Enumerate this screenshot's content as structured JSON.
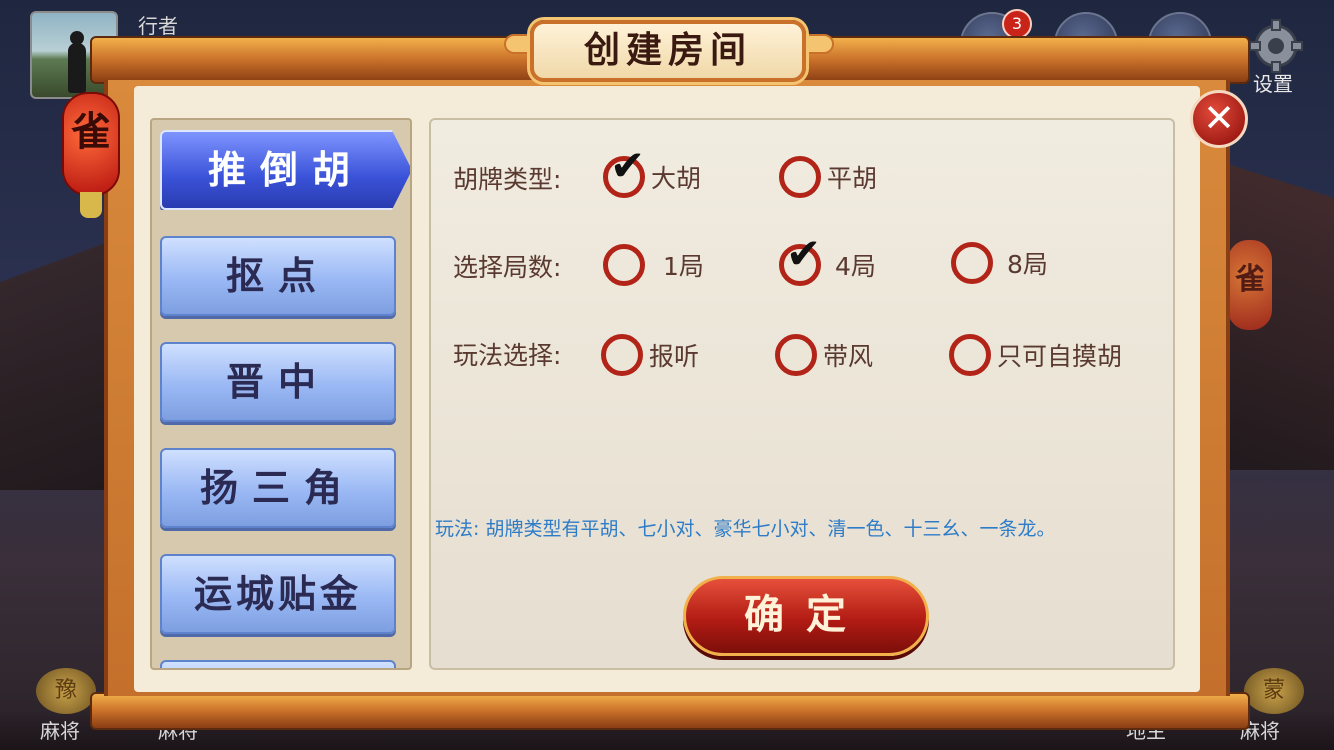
{
  "header": {
    "username": "行者",
    "mail_badge_count": "3",
    "settings_label": "设置"
  },
  "dialog": {
    "title": "创建房间",
    "lantern_char": "雀",
    "close_symbol": "✕",
    "rule_tabs": [
      {
        "label": "推倒胡",
        "active": true
      },
      {
        "label": "抠点",
        "active": false
      },
      {
        "label": "晋中",
        "active": false
      },
      {
        "label": "扬三角",
        "active": false
      },
      {
        "label": "运城贴金",
        "active": false
      }
    ],
    "rows": [
      {
        "label": "胡牌类型:",
        "options": [
          {
            "text": "大胡",
            "checked": true
          },
          {
            "text": "平胡",
            "checked": false
          }
        ]
      },
      {
        "label": "选择局数:",
        "options": [
          {
            "text": "1局",
            "checked": false
          },
          {
            "text": "4局",
            "checked": true
          },
          {
            "text": "8局",
            "checked": false
          }
        ]
      },
      {
        "label": "玩法选择:",
        "options": [
          {
            "text": "报听",
            "checked": false
          },
          {
            "text": "带风",
            "checked": false
          },
          {
            "text": "只可自摸胡",
            "checked": false
          }
        ]
      }
    ],
    "description": "玩法:  胡牌类型有平胡、七小对、豪华七小对、清一色、十三幺、一条龙。",
    "confirm_label": "确定",
    "check_mark": "✔"
  },
  "background": {
    "lantern_right_char": "雀",
    "bottom_left_badge": "豫",
    "bottom_left_caption": "麻将",
    "bottom_left2_caption": "麻将",
    "bottom_right_badge": "蒙",
    "bottom_right_caption": "麻将",
    "bottom_right2_caption": "地主"
  },
  "colors": {
    "accent_red": "#b22418",
    "tab_active_blue": "#3a52d8",
    "description_blue": "#2e7cc8"
  }
}
